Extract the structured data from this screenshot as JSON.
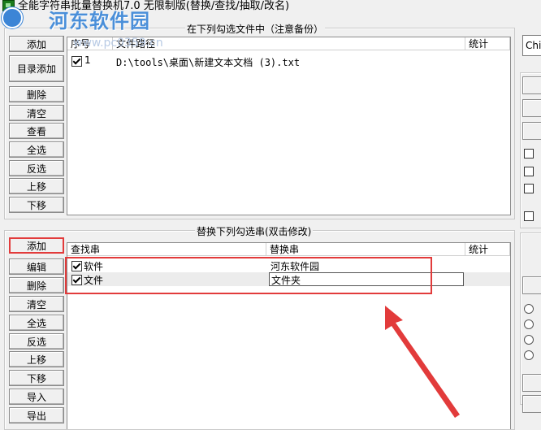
{
  "window": {
    "title": "全能字符串批量替换机7.0 无限制版(替换/查找/抽取/改名)"
  },
  "watermark": {
    "text": "河东软件园",
    "url": "www.pc0359.cn"
  },
  "files_group": {
    "title": "在下列勾选文件中（注意备份）",
    "buttons": {
      "add": "添加",
      "add_dir": "目录添加",
      "delete": "删除",
      "clear": "清空",
      "view": "查看",
      "select_all": "全选",
      "invert": "反选",
      "up": "上移",
      "down": "下移"
    },
    "columns": {
      "index": "序号",
      "path": "文件路径",
      "stats": "统计"
    },
    "rows": [
      {
        "index": "1",
        "path": "D:\\tools\\桌面\\新建文本文档 (3).txt",
        "checked": true
      }
    ]
  },
  "replace_group": {
    "title": "替换下列勾选串(双击修改)",
    "buttons": {
      "add": "添加",
      "edit": "编辑",
      "delete": "删除",
      "clear": "清空",
      "select_all": "全选",
      "invert": "反选",
      "up": "上移",
      "down": "下移",
      "import": "导入",
      "export": "导出"
    },
    "columns": {
      "find": "查找串",
      "replace": "替换串",
      "stats": "统计"
    },
    "rows": [
      {
        "find": "软件",
        "replace": "河东软件园",
        "checked": true
      },
      {
        "find": "文件",
        "replace": "文件夹",
        "checked": true
      }
    ]
  },
  "right_panel": {
    "encoding_value": "Chi"
  },
  "colors": {
    "highlight": "#e23b3b",
    "watermark": "#4a8fd9"
  }
}
